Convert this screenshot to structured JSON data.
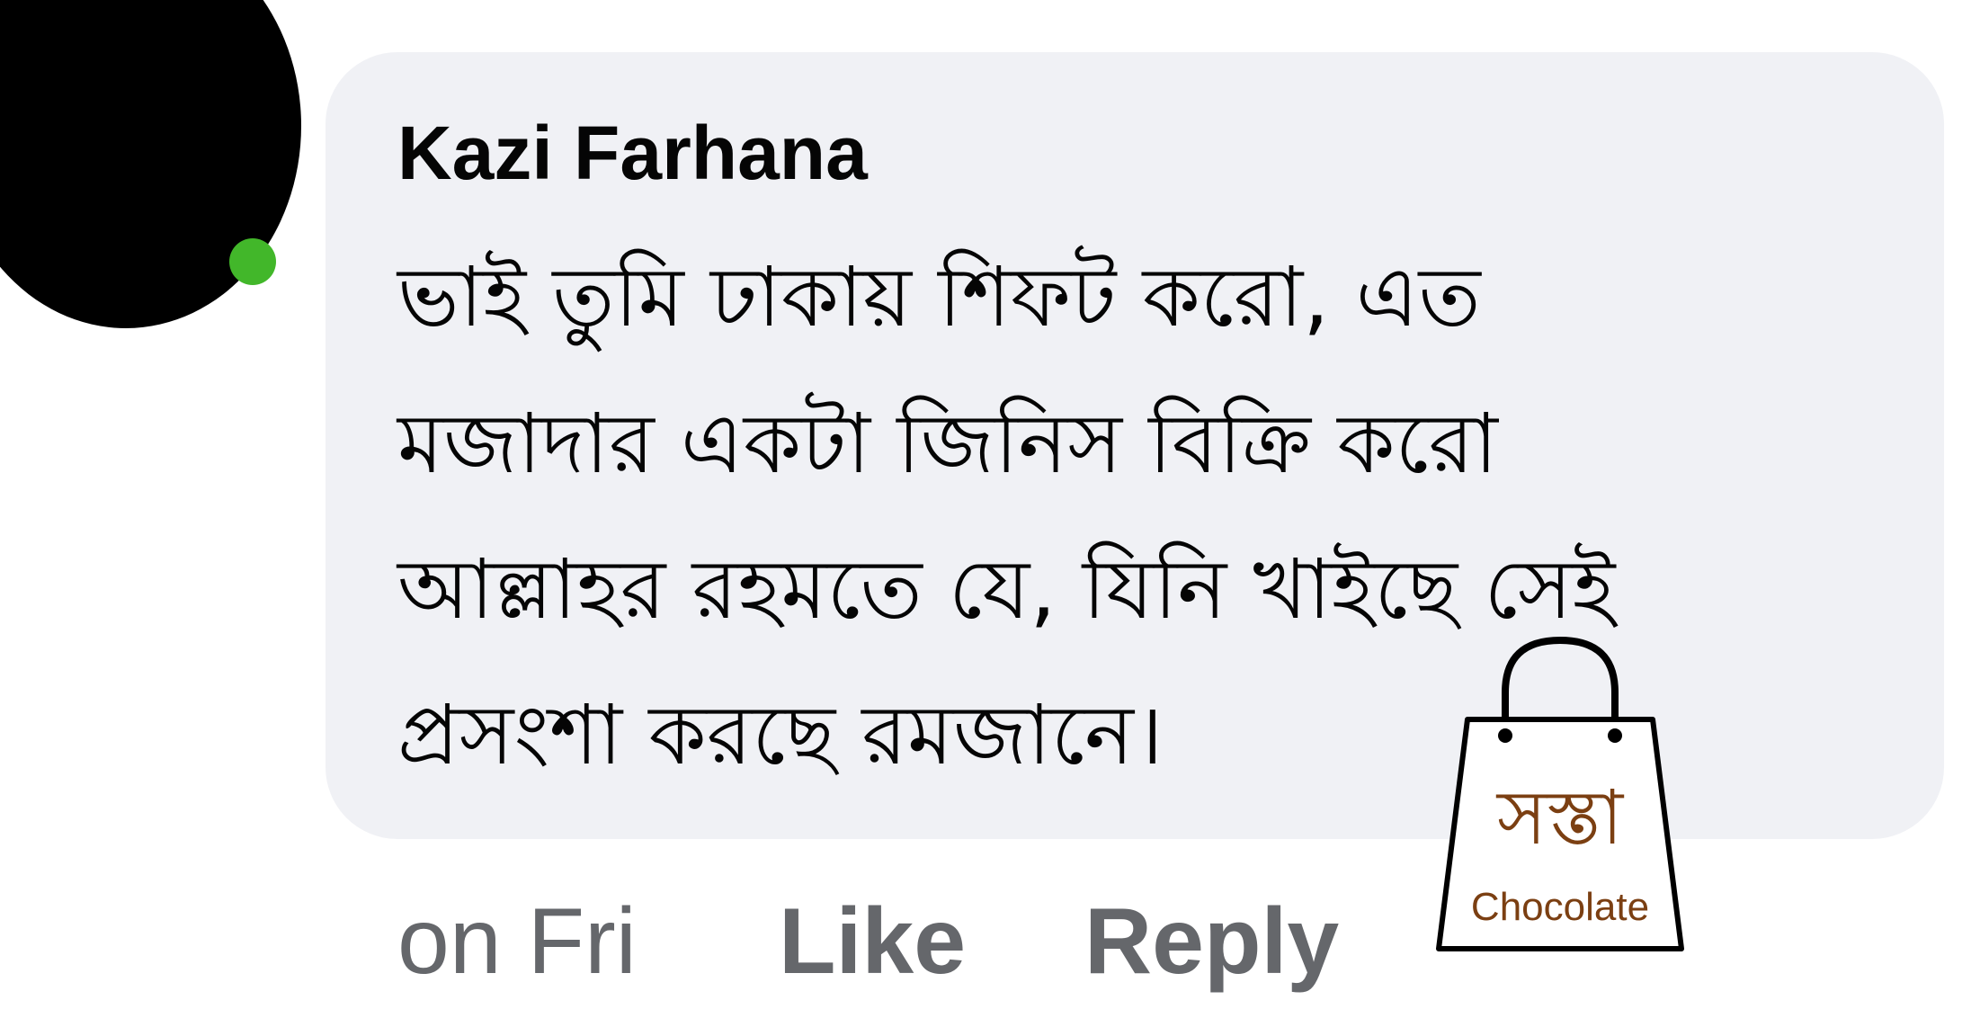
{
  "comment": {
    "author": "Kazi Farhana",
    "lines": [
      "ভাই তুমি ঢাকায় শিফট করো, এত",
      "মজাদার একটা জিনিস বিক্রি করো",
      "আল্লাহর রহমতে যে, যিনি খাইছে সেই",
      "প্রসংশা করছে রমজানে।"
    ],
    "time": "on Fri",
    "like_label": "Like",
    "reply_label": "Reply"
  },
  "watermark": {
    "brand_bn": "সস্তা",
    "brand_en": "Chocolate"
  },
  "colors": {
    "bubble": "#f0f1f5",
    "text": "#050505",
    "meta": "#65676b",
    "online": "#42b72a",
    "brand": "#7b3f12"
  }
}
